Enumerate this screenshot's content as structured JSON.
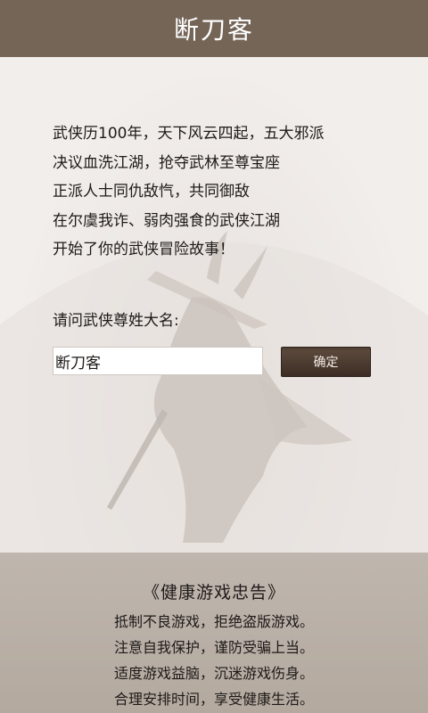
{
  "header": {
    "title": "断刀客"
  },
  "story": {
    "lines": [
      "武侠历100年，天下风云四起，五大邪派",
      "决议血洗江湖，抢夺武林至尊宝座",
      "正派人士同仇敌忾，共同御敌",
      "在尔虞我诈、弱肉强食的武侠江湖",
      "开始了你的武侠冒险故事！"
    ]
  },
  "form": {
    "prompt": "请问武侠尊姓大名:",
    "name_value": "断刀客",
    "confirm_label": "确定"
  },
  "notice": {
    "title": "《健康游戏忠告》",
    "lines": [
      "抵制不良游戏，拒绝盗版游戏。",
      "注意自我保护，谨防受骗上当。",
      "适度游戏益脑，沉迷游戏伤身。",
      "合理安排时间，享受健康生活。"
    ]
  }
}
